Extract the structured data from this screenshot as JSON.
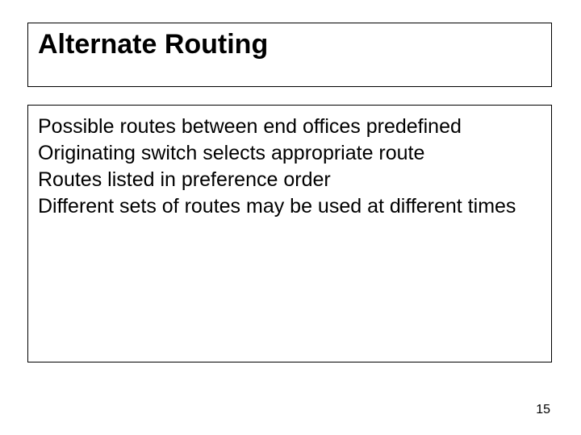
{
  "slide": {
    "title": "Alternate Routing",
    "bullets": [
      "Possible routes between end offices predefined",
      "Originating switch selects appropriate route",
      "Routes listed in preference order",
      "Different sets of routes may be used at different times"
    ],
    "page_number": "15"
  }
}
